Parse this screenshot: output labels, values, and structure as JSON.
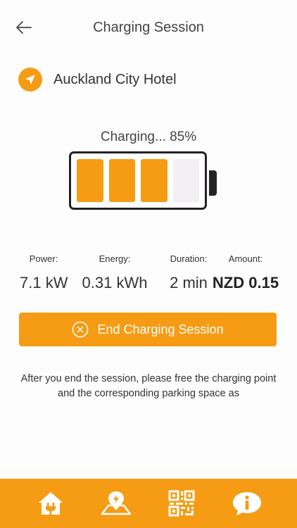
{
  "header": {
    "title": "Charging Session",
    "back_icon": "arrow-left-icon"
  },
  "location": {
    "name": "Auckland City Hotel",
    "icon": "navigation-arrow-icon"
  },
  "charging": {
    "status_text": "Charging... 85%",
    "battery_level": 0.85,
    "cells_filled": 3,
    "cells_total": 4
  },
  "stats": {
    "power": {
      "label": "Power:",
      "value": "7.1 kW"
    },
    "energy": {
      "label": "Energy:",
      "value": "0.31 kWh"
    },
    "duration": {
      "label": "Duration:",
      "value": "2 min"
    },
    "amount": {
      "label": "Amount:",
      "value": "NZD 0.15"
    }
  },
  "end_button": {
    "label": "End Charging Session",
    "icon": "close-circle-icon"
  },
  "info": {
    "text": "After you end the session, please free the charging point and the corresponding parking space as"
  },
  "bottom_nav": {
    "items": [
      {
        "icon": "home-plug-icon"
      },
      {
        "icon": "map-pin-icon"
      },
      {
        "icon": "qr-code-icon"
      },
      {
        "icon": "info-chat-icon"
      }
    ]
  },
  "colors": {
    "accent": "#f59c14",
    "empty_cell": "#f1eff1"
  }
}
